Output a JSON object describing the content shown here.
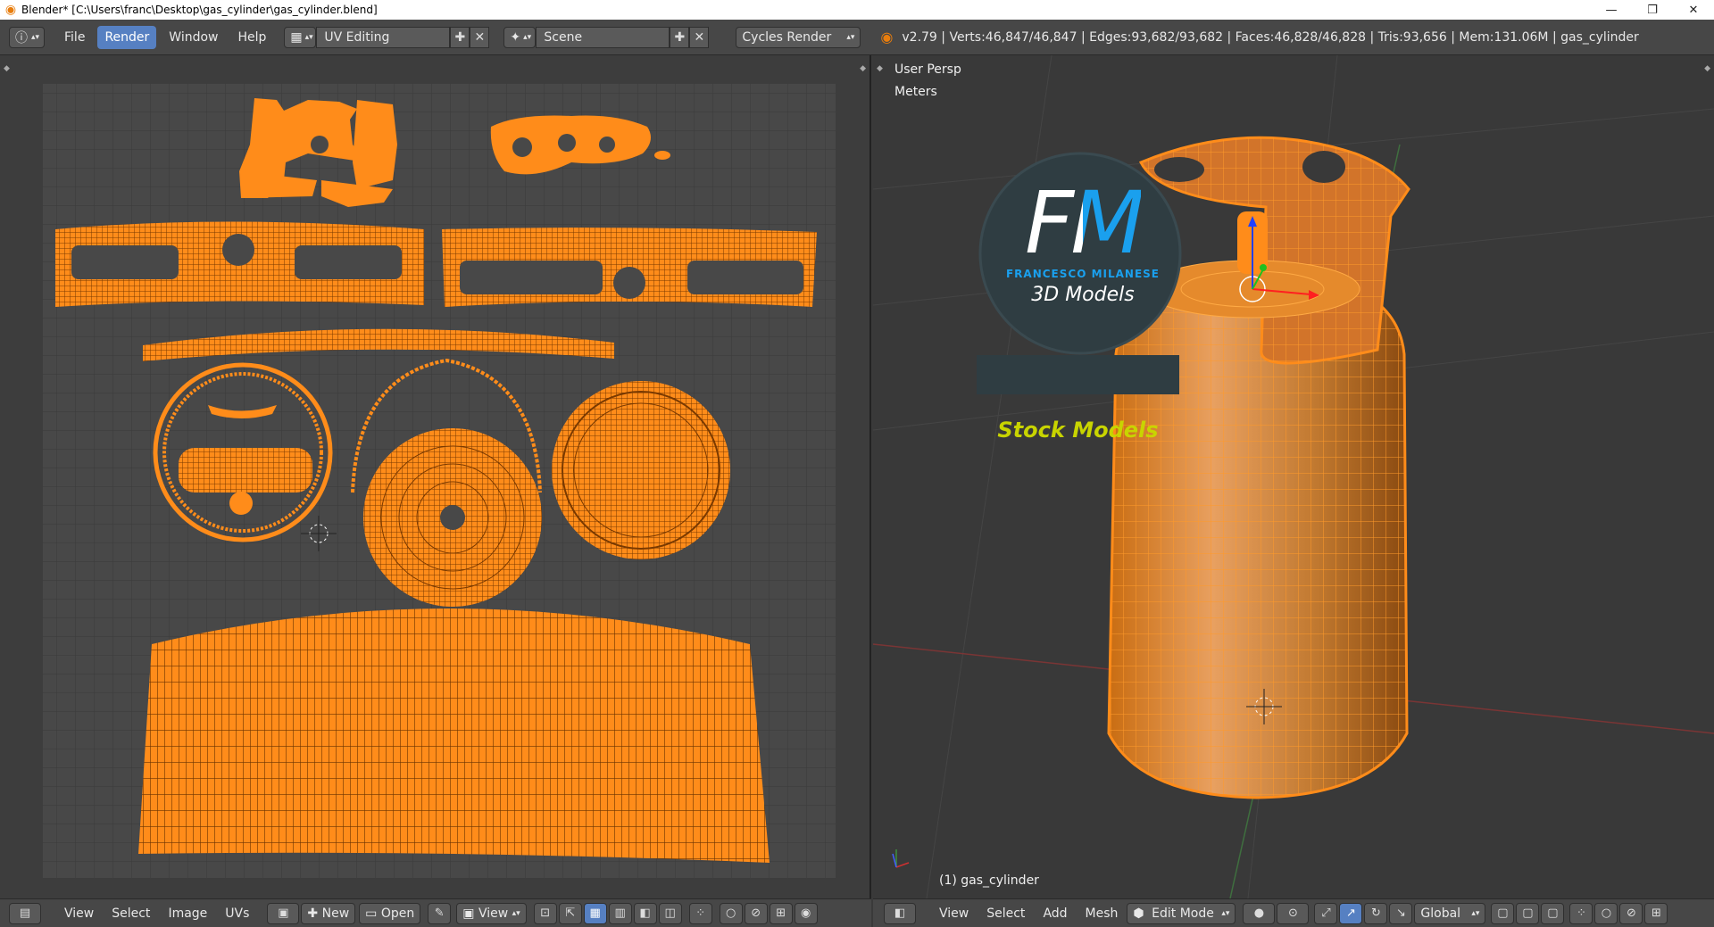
{
  "window": {
    "title": "Blender* [C:\\Users\\franc\\Desktop\\gas_cylinder\\gas_cylinder.blend]",
    "minimize": "—",
    "restore": "❐",
    "close": "✕"
  },
  "menu": {
    "items": [
      "File",
      "Render",
      "Window",
      "Help"
    ],
    "active": "Render"
  },
  "layout_selector": {
    "value": "UV Editing"
  },
  "scene_selector": {
    "value": "Scene"
  },
  "engine_selector": {
    "value": "Cycles Render"
  },
  "stats": "v2.79 | Verts:46,847/46,847 | Edges:93,682/93,682 | Faces:46,828/46,828 | Tris:93,656 | Mem:131.06M | gas_cylinder",
  "viewport": {
    "view_name": "User Persp",
    "units": "Meters",
    "object_label": "(1) gas_cylinder"
  },
  "watermark": {
    "logo_text": "FM",
    "brand": "FRANCESCO MILANESE",
    "subtitle": "3D Models",
    "banner": "Stock Models"
  },
  "uv_toolbar": {
    "items": [
      "View",
      "Select",
      "Image",
      "UVs"
    ],
    "new_label": "New",
    "open_label": "Open",
    "view_label": "View"
  },
  "v3d_toolbar": {
    "items": [
      "View",
      "Select",
      "Add",
      "Mesh"
    ],
    "mode": "Edit Mode",
    "orientation": "Global"
  },
  "colors": {
    "accent": "#5680c2",
    "mesh": "#ff8c1a",
    "header_bg": "#474747"
  }
}
